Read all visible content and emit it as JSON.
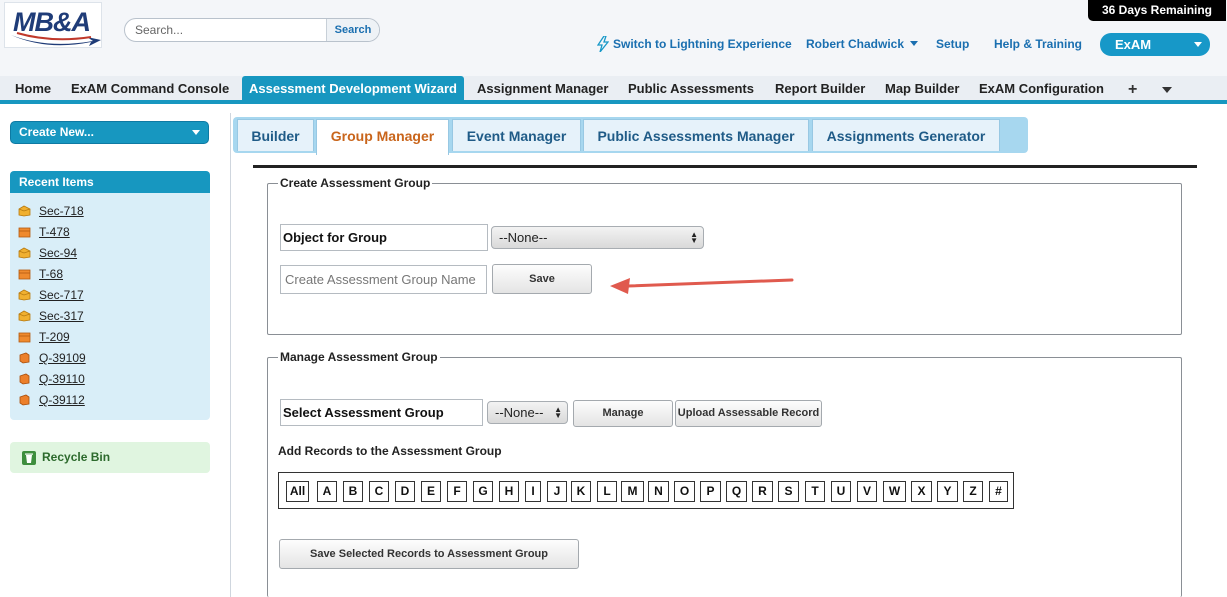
{
  "header": {
    "logo_text": "MB&A",
    "search": {
      "placeholder": "Search...",
      "button": "Search"
    },
    "trial_badge": "36 Days Remaining",
    "links": {
      "lightning": "Switch to Lightning Experience",
      "user": "Robert Chadwick",
      "setup": "Setup",
      "help": "Help & Training"
    },
    "app_switcher": "ExAM"
  },
  "tabs": [
    {
      "label": "Home"
    },
    {
      "label": "ExAM Command Console"
    },
    {
      "label": "Assessment Development Wizard"
    },
    {
      "label": "Assignment Manager"
    },
    {
      "label": "Public Assessments"
    },
    {
      "label": "Report Builder"
    },
    {
      "label": "Map Builder"
    },
    {
      "label": "ExAM Configuration"
    }
  ],
  "tab_plus": "+",
  "sidebar": {
    "create_new": "Create New...",
    "recent_title": "Recent Items",
    "recent_items": [
      {
        "label": "Sec-718",
        "icon": "section-icon"
      },
      {
        "label": "T-478",
        "icon": "template-icon"
      },
      {
        "label": "Sec-94",
        "icon": "section-icon"
      },
      {
        "label": "T-68",
        "icon": "template-icon"
      },
      {
        "label": "Sec-717",
        "icon": "section-icon"
      },
      {
        "label": "Sec-317",
        "icon": "section-icon"
      },
      {
        "label": "T-209",
        "icon": "template-icon"
      },
      {
        "label": "Q-39109",
        "icon": "question-icon"
      },
      {
        "label": "Q-39110",
        "icon": "question-icon"
      },
      {
        "label": "Q-39112",
        "icon": "question-icon"
      }
    ],
    "recycle_bin": "Recycle Bin"
  },
  "subtabs": [
    {
      "label": "Builder"
    },
    {
      "label": "Group Manager"
    },
    {
      "label": "Event Manager"
    },
    {
      "label": "Public Assessments Manager"
    },
    {
      "label": "Assignments Generator"
    }
  ],
  "create_group": {
    "legend": "Create Assessment Group",
    "object_label": "Object for Group",
    "object_value": "--None--",
    "name_placeholder": "Create Assessment Group Name",
    "save": "Save"
  },
  "manage_group": {
    "legend": "Manage Assessment Group",
    "select_label": "Select Assessment Group",
    "select_value": "--None--",
    "manage": "Manage",
    "upload": "Upload Assessable Record",
    "add_records_label": "Add Records to the Assessment Group",
    "letters": [
      "All",
      "A",
      "B",
      "C",
      "D",
      "E",
      "F",
      "G",
      "H",
      "I",
      "J",
      "K",
      "L",
      "M",
      "N",
      "O",
      "P",
      "Q",
      "R",
      "S",
      "T",
      "U",
      "V",
      "W",
      "X",
      "Y",
      "Z",
      "#"
    ],
    "save_selected": "Save Selected Records to Assessment Group"
  },
  "colors": {
    "accent": "#1797c0",
    "active_subtab_text": "#c9651b",
    "annotation_arrow": "#e05a4e"
  }
}
